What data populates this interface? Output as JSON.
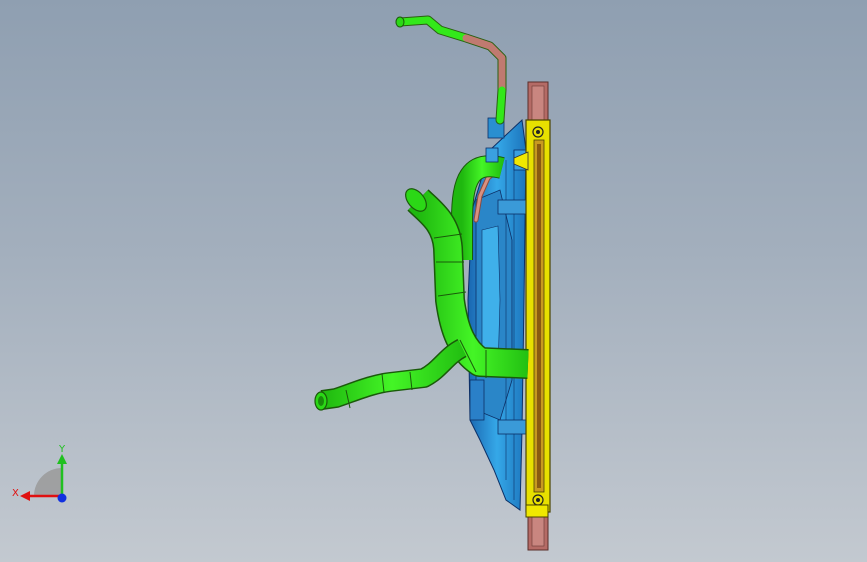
{
  "viewport": {
    "background_top": "#8f9fb1",
    "background_bottom": "#c3c9d0"
  },
  "model": {
    "hose_color": "#33e81a",
    "copper_color": "#c07a70",
    "frame_color": "#e8e000",
    "shroud_color": "#2a8fd0"
  },
  "triad": {
    "x_label": "X",
    "y_label": "Y",
    "x_color": "#e01010",
    "y_color": "#20c020",
    "z_color": "#1030e0"
  }
}
